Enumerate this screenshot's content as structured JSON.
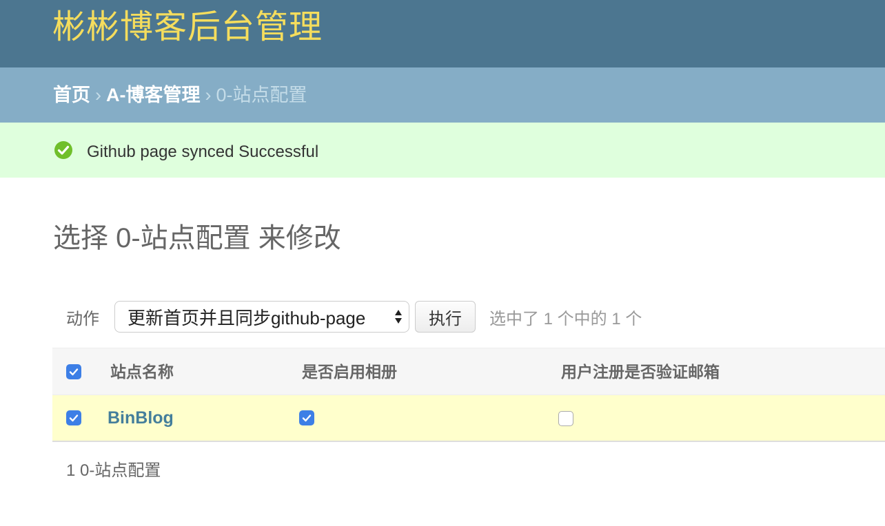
{
  "header": {
    "brand": "彬彬博客后台管理"
  },
  "breadcrumbs": {
    "home": "首页",
    "separator": "›",
    "app": "A-博客管理",
    "current": "0-站点配置"
  },
  "message": {
    "icon": "success-check-icon",
    "text": "Github page synced Successful",
    "color": "#70bf2b"
  },
  "page": {
    "title": "选择 0-站点配置 来修改"
  },
  "actions": {
    "label": "动作",
    "selected_action": "更新首页并且同步github-page",
    "go_button": "执行",
    "counter": "选中了 1 个中的 1 个"
  },
  "table": {
    "columns": [
      "站点名称",
      "是否启用相册",
      "用户注册是否验证邮箱"
    ],
    "rows": [
      {
        "selected": true,
        "name": "BinBlog",
        "album_enabled": true,
        "email_verify": false
      }
    ]
  },
  "footer": {
    "count_text": "1 0-站点配置"
  },
  "colors": {
    "header_bg": "#4c7690",
    "brand": "#f5dd5d",
    "breadcrumbs_bg": "#85adc6",
    "message_bg": "#dfffdd",
    "row_selected_bg": "#ffffcc",
    "checkbox": "#3d7fe6"
  }
}
